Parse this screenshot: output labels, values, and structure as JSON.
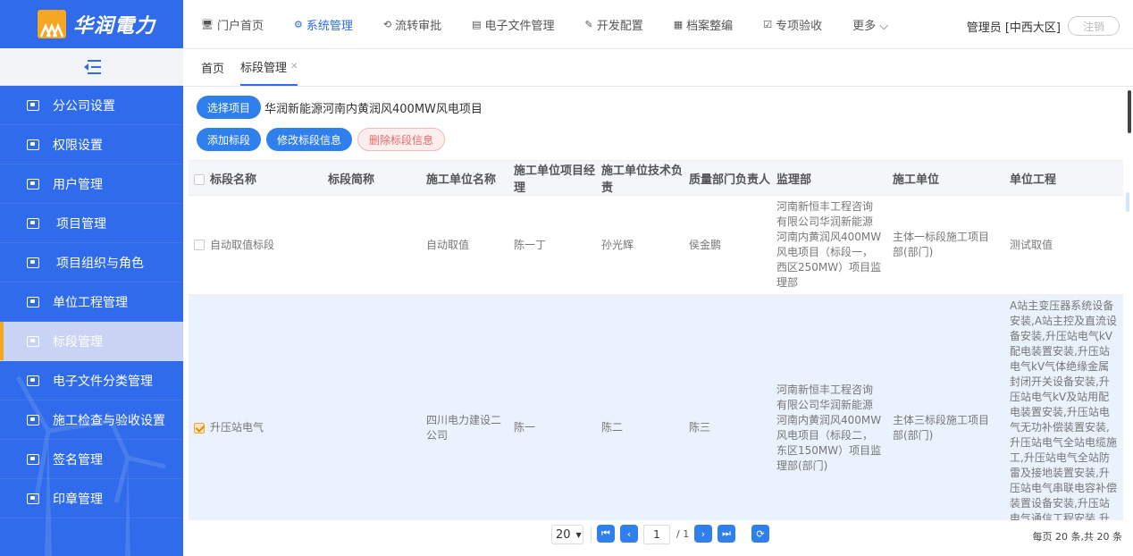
{
  "brand": {
    "name": "华润電力"
  },
  "nav": [
    {
      "icon": "🖥",
      "label": "门户首页"
    },
    {
      "icon": "⚙",
      "label": "系统管理"
    },
    {
      "icon": "⟲",
      "label": "流转审批"
    },
    {
      "icon": "▤",
      "label": "电子文件管理"
    },
    {
      "icon": "✎",
      "label": "开发配置"
    },
    {
      "icon": "▦",
      "label": "档案整编"
    },
    {
      "icon": "☑",
      "label": "专项验收"
    },
    {
      "icon": "",
      "label": "更多 ⌵"
    }
  ],
  "user": {
    "name": "管理员 [中西大区]",
    "logout": "注销"
  },
  "sidebar": {
    "items": [
      {
        "label": "分公司设置"
      },
      {
        "label": "权限设置"
      },
      {
        "label": "用户管理"
      },
      {
        "label": "项目管理"
      },
      {
        "label": "项目组织与角色"
      },
      {
        "label": "单位工程管理"
      },
      {
        "label": "标段管理"
      },
      {
        "label": "电子文件分类管理"
      },
      {
        "label": "施工检查与验收设置"
      },
      {
        "label": "签名管理"
      },
      {
        "label": "印章管理"
      }
    ]
  },
  "tabs": [
    {
      "label": "首页"
    },
    {
      "label": "标段管理"
    }
  ],
  "toolbar": {
    "select_project": "选择项目",
    "project_name": "华润新能源河南内黄润风400MW风电项目",
    "add": "添加标段",
    "edit": "修改标段信息",
    "delete": "删除标段信息"
  },
  "table": {
    "headers": [
      "标段名称",
      "标段简称",
      "施工单位名称",
      "施工单位项目经理",
      "施工单位技术负责",
      "质量部门负责人",
      "监理部",
      "施工单位",
      "单位工程"
    ],
    "rows": [
      [
        "自动取值标段",
        "",
        "自动取值",
        "陈一丁",
        "孙光辉",
        "侯金鹏",
        "河南新恒丰工程咨询有限公司华润新能源河南内黄润风400MW风电项目（标段一，西区250MW）项目监理部",
        "主体一标段施工项目部(部门)",
        "测试取值"
      ],
      [
        "升压站电气",
        "",
        "四川电力建设二公司",
        "陈一",
        "陈二",
        "陈三",
        "河南新恒丰工程咨询有限公司华润新能源河南内黄润风400MW风电项目（标段二，东区150MW）项目监理部(部门)",
        "主体三标段施工项目部(部门)",
        "A站主变压器系统设备安装,A站主控及直流设备安装,升压站电气kV配电装置安装,升压站电气kV气体绝缘金属封闭开关设备安装,升压站电气kV及站用配电装置安装,升压站电气无功补偿装置安装,升压站电气全站电缆施工,升压站电气全站防雷及接地装置安装,升压站电气串联电容补偿装置设备安装,升压站电气通信工程安装,升压站电气电气设备分系统调试"
      ]
    ]
  },
  "pagination": {
    "page_size": "20",
    "current": "1",
    "total_pages": "/ 1",
    "info": "每页 20 条,共 20 条"
  },
  "colors": {
    "brand_blue": "#2f6bea",
    "accent_orange": "#f5a623",
    "primary_button": "#2f80ed"
  }
}
